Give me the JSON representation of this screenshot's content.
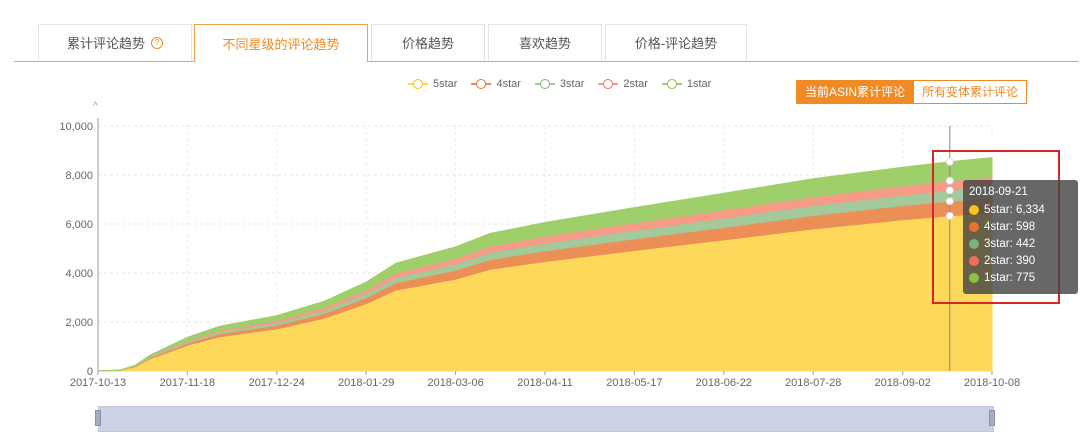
{
  "tabs": [
    {
      "label": "累计评论趋势",
      "info": "?"
    },
    {
      "label": "不同星级的评论趋势"
    },
    {
      "label": "价格趋势"
    },
    {
      "label": "喜欢趋势"
    },
    {
      "label": "价格-评论趋势"
    }
  ],
  "toggle": {
    "left_label": "当前ASIN累计评论",
    "right_label": "所有变体累计评论"
  },
  "legend": [
    "5star",
    "4star",
    "3star",
    "2star",
    "1star"
  ],
  "colors": {
    "accent": "#f08a24",
    "5star": "#fdd85b",
    "4star": "#ec8f56",
    "3star": "#a4c99a",
    "2star": "#f59b88",
    "1star": "#9fcf6a"
  },
  "tooltip": {
    "date": "2018-09-21",
    "rows": [
      {
        "label": "5star: 6,334",
        "color": "#f5c518"
      },
      {
        "label": "4star: 598",
        "color": "#e8732e"
      },
      {
        "label": "3star: 442",
        "color": "#7fb27a"
      },
      {
        "label": "2star: 390",
        "color": "#f2705a"
      },
      {
        "label": "1star: 775",
        "color": "#8dc13f"
      }
    ]
  },
  "chart_data": {
    "type": "area",
    "stacked": true,
    "title": "",
    "xlabel": "",
    "ylabel": "",
    "ylim": [
      0,
      10000
    ],
    "y_ticks": [
      "0",
      "2,000",
      "4,000",
      "6,000",
      "8,000",
      "10,000"
    ],
    "x_ticks": [
      "2017-10-13",
      "2017-11-18",
      "2017-12-24",
      "2018-01-29",
      "2018-03-06",
      "2018-04-11",
      "2018-05-17",
      "2018-06-22",
      "2018-07-28",
      "2018-09-02",
      "2018-10-08"
    ],
    "x_range": [
      "2017-10-13",
      "2018-10-08"
    ],
    "grid": true,
    "legend_position": "top",
    "x": [
      "2017-10-13",
      "2017-10-22",
      "2017-10-28",
      "2017-11-03",
      "2017-11-18",
      "2017-12-01",
      "2017-12-24",
      "2018-01-12",
      "2018-01-29",
      "2018-02-10",
      "2018-03-06",
      "2018-03-20",
      "2018-04-11",
      "2018-05-17",
      "2018-06-22",
      "2018-07-28",
      "2018-09-02",
      "2018-09-21",
      "2018-10-08"
    ],
    "series": [
      {
        "name": "5star",
        "values": [
          0,
          30,
          180,
          500,
          1050,
          1400,
          1720,
          2150,
          2750,
          3300,
          3750,
          4150,
          4470,
          4920,
          5350,
          5800,
          6170,
          6334,
          6450
        ]
      },
      {
        "name": "4star",
        "values": [
          0,
          3,
          15,
          40,
          90,
          120,
          150,
          190,
          240,
          300,
          360,
          400,
          430,
          470,
          510,
          545,
          580,
          598,
          615
        ]
      },
      {
        "name": "3star",
        "values": [
          0,
          2,
          10,
          30,
          60,
          80,
          100,
          130,
          170,
          210,
          260,
          290,
          320,
          350,
          380,
          410,
          430,
          442,
          455
        ]
      },
      {
        "name": "2star",
        "values": [
          0,
          2,
          10,
          25,
          50,
          70,
          90,
          120,
          150,
          190,
          230,
          255,
          280,
          310,
          335,
          360,
          380,
          390,
          400
        ]
      },
      {
        "name": "1star",
        "values": [
          0,
          3,
          20,
          60,
          120,
          160,
          200,
          250,
          320,
          400,
          470,
          520,
          560,
          620,
          680,
          730,
          760,
          775,
          790
        ]
      }
    ],
    "highlight_x": "2018-09-21"
  }
}
